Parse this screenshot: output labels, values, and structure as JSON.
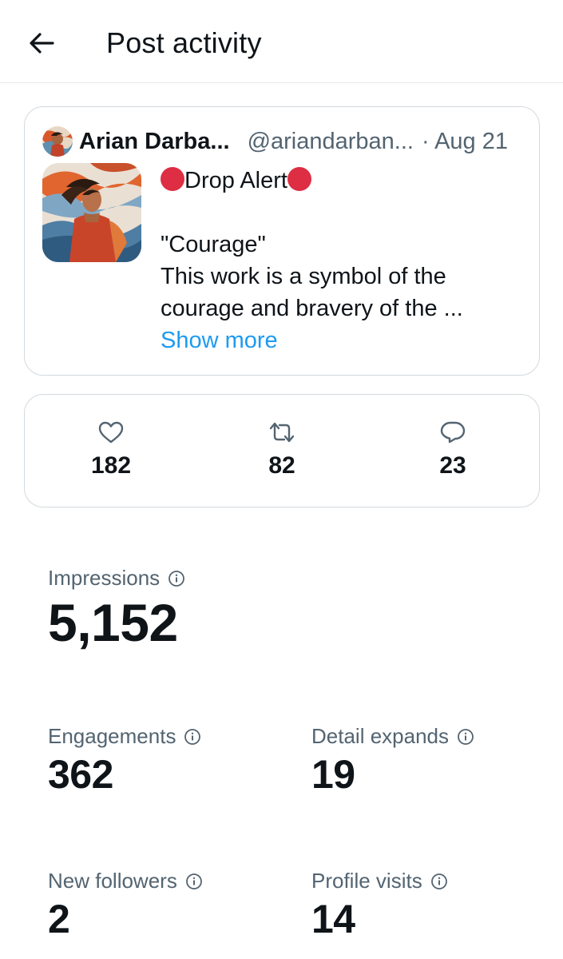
{
  "header": {
    "title": "Post activity",
    "back_icon": "arrow-left-icon"
  },
  "post": {
    "author_name": "Arian Darba...",
    "author_handle": "@ariandarban...",
    "date": "· Aug 21",
    "lines": {
      "alert": "Drop Alert",
      "title": "\"Courage\"",
      "body1": "This work is a symbol of the",
      "body2": "courage and bravery of the ..."
    },
    "show_more": "Show more"
  },
  "stats": {
    "likes": "182",
    "reposts": "82",
    "replies": "23"
  },
  "metrics": {
    "impressions": {
      "label": "Impressions",
      "value": "5,152"
    },
    "engagements": {
      "label": "Engagements",
      "value": "362"
    },
    "detail_expands": {
      "label": "Detail expands",
      "value": "19"
    },
    "new_followers": {
      "label": "New followers",
      "value": "2"
    },
    "profile_visits": {
      "label": "Profile visits",
      "value": "14"
    }
  },
  "colors": {
    "text": "#0f1419",
    "secondary": "#536471",
    "link": "#1d9bf0",
    "alert_dot": "#dd2e44",
    "border": "#d3d9de"
  }
}
